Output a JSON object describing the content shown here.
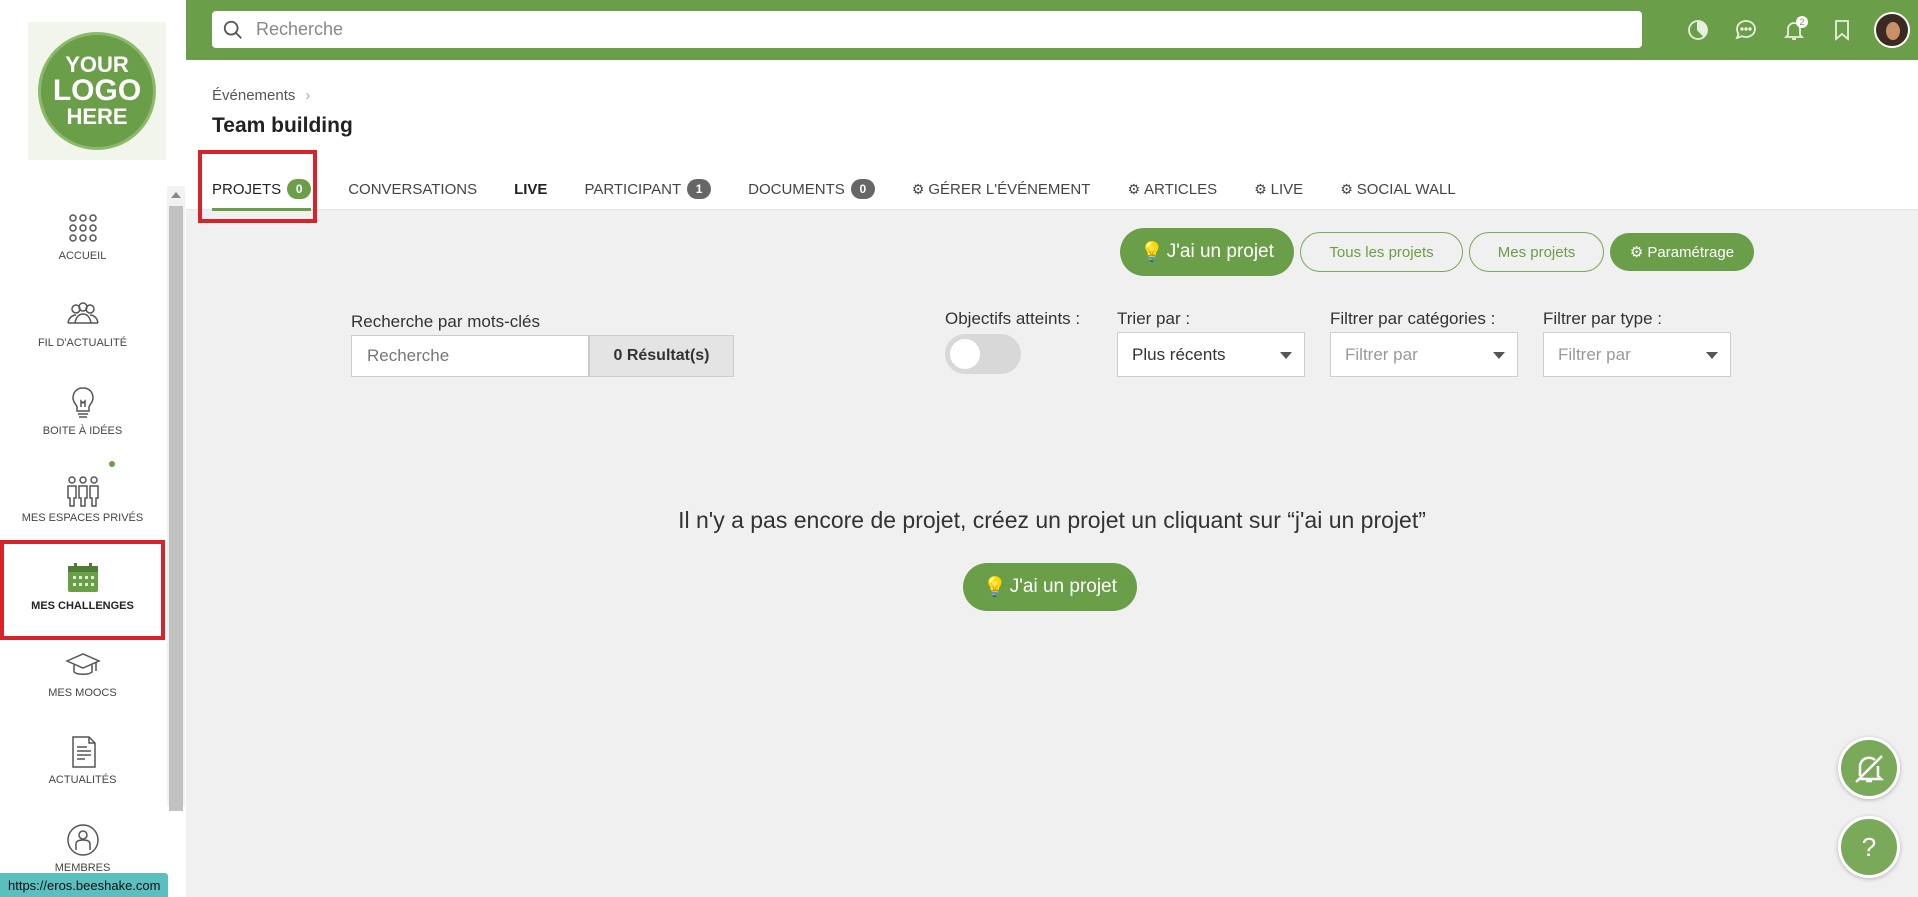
{
  "logo": {
    "line1": "YOUR",
    "line2": "LOGO",
    "line3": "HERE"
  },
  "sidebar": {
    "items": [
      {
        "label": "ACCUEIL",
        "icon": "grid-icon"
      },
      {
        "label": "FIL D'ACTUALITÉ",
        "icon": "people-icon"
      },
      {
        "label": "BOITE À IDÉES",
        "icon": "lightbulb-icon"
      },
      {
        "label": "MES ESPACES PRIVÉS",
        "icon": "group-icon"
      },
      {
        "label": "MES CHALLENGES",
        "icon": "calendar-icon",
        "active": true
      },
      {
        "label": "MES MOOCS",
        "icon": "graduation-cap-icon"
      },
      {
        "label": "ACTUALITÉS",
        "icon": "news-icon"
      },
      {
        "label": "MEMBRES",
        "icon": "member-icon"
      }
    ]
  },
  "topbar": {
    "search_placeholder": "Recherche",
    "notification_count": "2"
  },
  "breadcrumb": {
    "parent": "Événements"
  },
  "page": {
    "title": "Team building"
  },
  "tabs": [
    {
      "label": "PROJETS",
      "count": "0"
    },
    {
      "label": "CONVERSATIONS"
    },
    {
      "label": "LIVE"
    },
    {
      "label": "PARTICIPANT",
      "count": "1"
    },
    {
      "label": "DOCUMENTS",
      "count": "0"
    },
    {
      "label": "GÉRER L'ÉVÉNEMENT"
    },
    {
      "label": "ARTICLES"
    },
    {
      "label": "LIVE"
    },
    {
      "label": "SOCIAL WALL"
    }
  ],
  "actions": {
    "new_project": "J'ai un projet",
    "all_projects": "Tous les projets",
    "my_projects": "Mes projets",
    "settings": "Paramétrage"
  },
  "filters": {
    "keyword_label": "Recherche par mots-clés",
    "keyword_placeholder": "Recherche",
    "result_text": "0 Résultat(s)",
    "objectives_label": "Objectifs atteints :",
    "sort_label": "Trier par :",
    "sort_value": "Plus récents",
    "category_label": "Filtrer par catégories :",
    "category_placeholder": "Filtrer par",
    "type_label": "Filtrer par type :",
    "type_placeholder": "Filtrer par"
  },
  "empty": {
    "message": "Il n'y a pas encore de projet, créez un projet un cliquant sur “j'ai un projet”",
    "button": "J'ai un projet"
  },
  "fab": {
    "help": "?"
  },
  "status_url": "https://eros.beeshake.com",
  "colors": {
    "accent": "#6b9e49",
    "highlight": "#d8232a"
  }
}
